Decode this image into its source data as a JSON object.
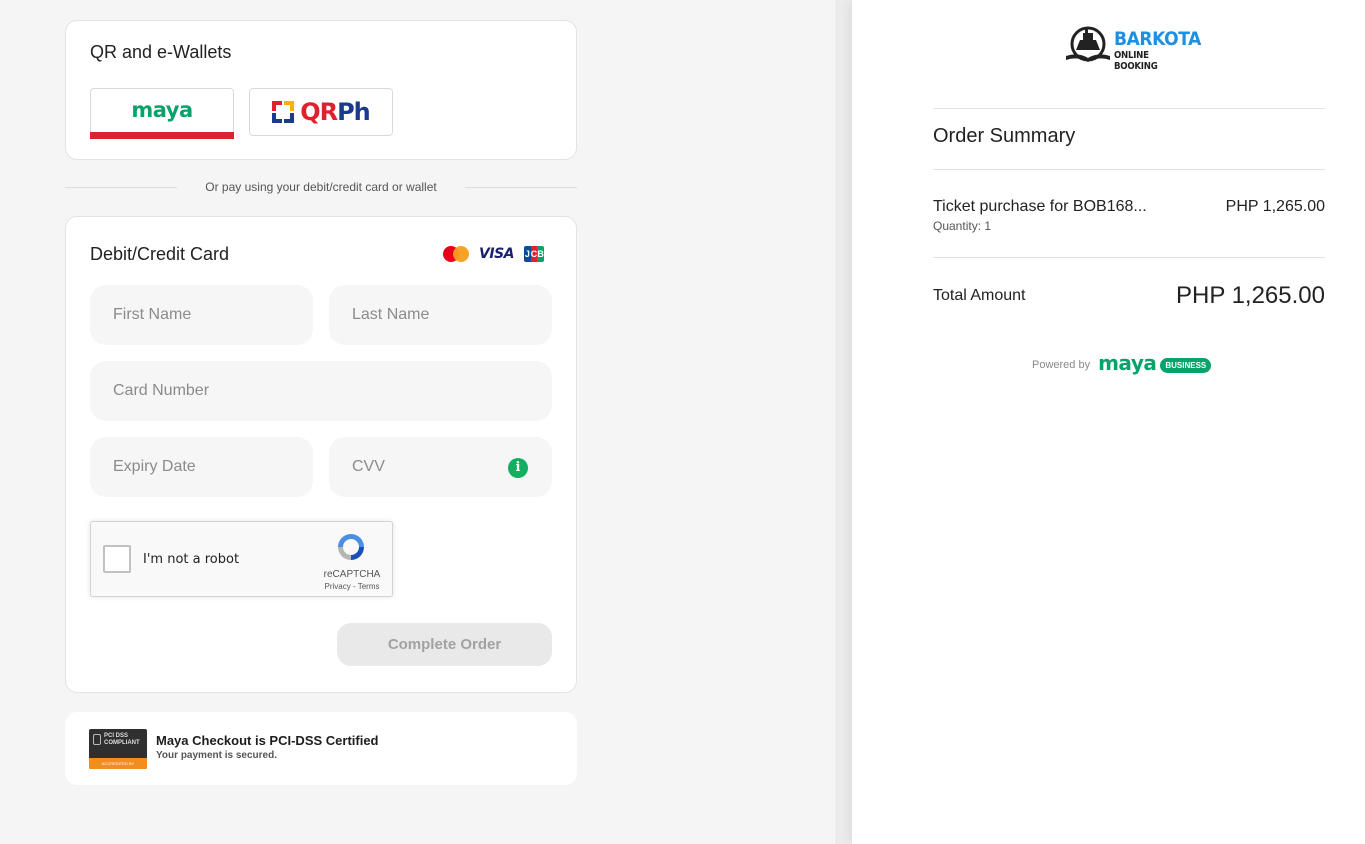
{
  "wallets": {
    "title": "QR and e-Wallets",
    "maya_label": "maya",
    "qrph_label": "QR",
    "qrph_suffix": "Ph"
  },
  "divider_text": "Or pay using your debit/credit card or wallet",
  "card_form": {
    "title": "Debit/Credit Card",
    "visa_label": "VISA",
    "jcb_letters": [
      "J",
      "C",
      "B"
    ],
    "first_name_placeholder": "First Name",
    "last_name_placeholder": "Last Name",
    "card_number_placeholder": "Card Number",
    "expiry_placeholder": "Expiry Date",
    "cvv_placeholder": "CVV",
    "info_icon_glyph": "i",
    "submit_label": "Complete Order"
  },
  "recaptcha": {
    "label": "I'm not a robot",
    "brand": "reCAPTCHA",
    "links": "Privacy - Terms"
  },
  "pci": {
    "badge_top": "PCI DSS COMPLIANT",
    "badge_bottom": "ACCREDITED BY CONTROLCASE",
    "title": "Maya Checkout is PCI-DSS Certified",
    "subtitle": "Your payment is secured."
  },
  "merchant": {
    "name": "BARKOTA",
    "tagline": "ONLINE BOOKING"
  },
  "order": {
    "title": "Order Summary",
    "item_name": "Ticket purchase for BOB168...",
    "item_quantity": "Quantity: 1",
    "item_price": "PHP 1,265.00",
    "total_label": "Total Amount",
    "total_value": "PHP 1,265.00"
  },
  "powered": {
    "label": "Powered by",
    "brand": "maya",
    "badge": "BUSINESS"
  },
  "colors": {
    "maya_green": "#07a36b",
    "maya_red": "#e0202e",
    "qrph_blue": "#1b3a8c",
    "barkota_blue": "#1e8fe1",
    "info_green": "#10b060"
  }
}
